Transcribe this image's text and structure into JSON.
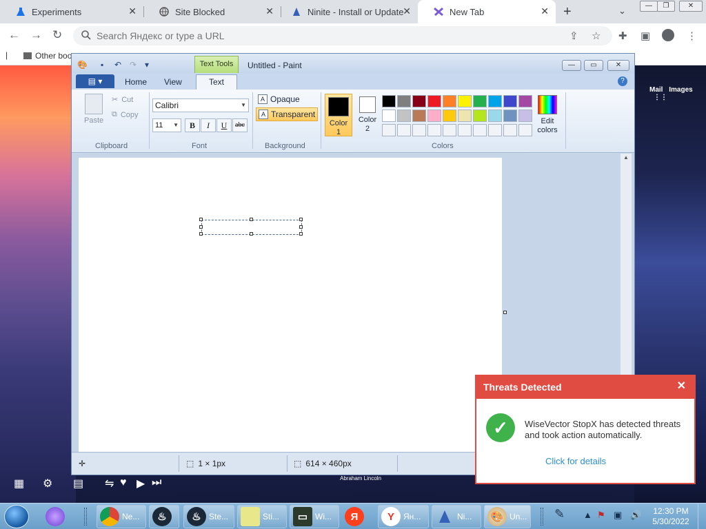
{
  "browser": {
    "tabs": [
      {
        "title": "Experiments",
        "icon": "flask-icon"
      },
      {
        "title": "Site Blocked",
        "icon": "globe-icon"
      },
      {
        "title": "Ninite - Install or Update",
        "icon": "ninite-icon"
      },
      {
        "title": "New Tab",
        "icon": "new-tab-icon",
        "active": true
      }
    ],
    "omnibox_placeholder": "Search Яндекс or type a URL",
    "bookmark": "Other boo"
  },
  "desktop_links": {
    "mail": "Mail",
    "images": "Images"
  },
  "desktop_quote": "Abraham Lincoln",
  "paint": {
    "title": "Untitled - Paint",
    "contextual_tab": "Text Tools",
    "tabs": [
      "Home",
      "View",
      "Text"
    ],
    "active_tab": "Text",
    "clipboard": {
      "paste": "Paste",
      "cut": "Cut",
      "copy": "Copy",
      "label": "Clipboard"
    },
    "font": {
      "family": "Calibri",
      "size": "11",
      "bold": "B",
      "italic": "I",
      "underline": "U",
      "strike": "abc",
      "label": "Font"
    },
    "background": {
      "opaque": "Opaque",
      "transparent": "Transparent",
      "selected": "Transparent",
      "label": "Background"
    },
    "colors": {
      "color1_label": "Color 1",
      "color2_label": "Color 2",
      "color1": "#000000",
      "color2": "#ffffff",
      "edit_label": "Edit colors",
      "label": "Colors",
      "palette_row1": [
        "#000000",
        "#7f7f7f",
        "#880015",
        "#ed1c24",
        "#ff7f27",
        "#fff200",
        "#22b14c",
        "#00a2e8",
        "#3f48cc",
        "#a349a4"
      ],
      "palette_row2": [
        "#ffffff",
        "#c3c3c3",
        "#b97a57",
        "#ffaec9",
        "#ffc90e",
        "#efe4b0",
        "#b5e61d",
        "#99d9ea",
        "#7092be",
        "#c8bfe7"
      ]
    },
    "status": {
      "selection": "1 × 1px",
      "canvas": "614 × 460px"
    }
  },
  "notification": {
    "title": "Threats Detected",
    "message": "WiseVector StopX has detected threats and took action automatically.",
    "link": "Click for details",
    "accent": "#e04b42"
  },
  "taskbar": {
    "buttons": [
      {
        "label": "Ne...",
        "icon": "chrome-icon"
      },
      {
        "label": "",
        "icon": "steam-icon"
      },
      {
        "label": "Ste...",
        "icon": "steam-icon"
      },
      {
        "label": "Sti...",
        "icon": "sticky-notes-icon"
      },
      {
        "label": "Wi...",
        "icon": "terminal-icon"
      },
      {
        "label": "Я",
        "icon": "yandex-icon"
      },
      {
        "label": "Ян...",
        "icon": "yandex-browser-icon"
      },
      {
        "label": "Ni...",
        "icon": "ninite-icon"
      },
      {
        "label": "Un...",
        "icon": "paint-icon"
      }
    ],
    "time": "12:30 PM",
    "date": "5/30/2022"
  }
}
